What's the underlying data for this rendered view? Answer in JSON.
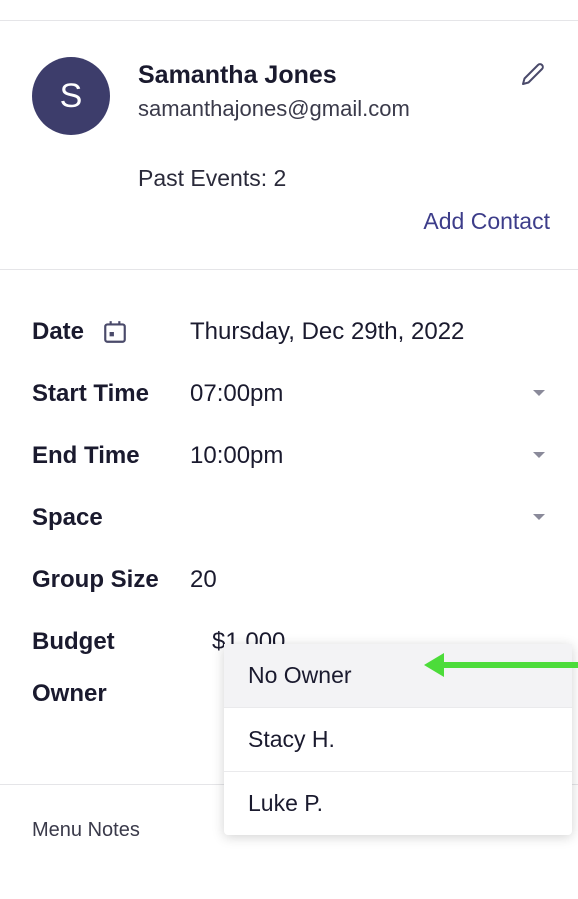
{
  "contact": {
    "avatarInitial": "S",
    "name": "Samantha Jones",
    "email": "samanthajones@gmail.com",
    "pastEventsLabel": "Past Events: 2",
    "addContactLabel": "Add Contact"
  },
  "details": {
    "dateLabel": "Date",
    "dateValue": "Thursday, Dec 29th, 2022",
    "startTimeLabel": "Start Time",
    "startTimeValue": "07:00pm",
    "endTimeLabel": "End Time",
    "endTimeValue": "10:00pm",
    "spaceLabel": "Space",
    "spaceValue": "",
    "groupSizeLabel": "Group Size",
    "groupSizeValue": "20",
    "budgetLabel": "Budget",
    "budgetValue": "$1,000",
    "ownerLabel": "Owner"
  },
  "ownerDropdown": {
    "options": [
      "No Owner",
      "Stacy H.",
      "Luke P."
    ],
    "highlightedIndex": 0
  },
  "menuNotesLabel": "Menu Notes"
}
